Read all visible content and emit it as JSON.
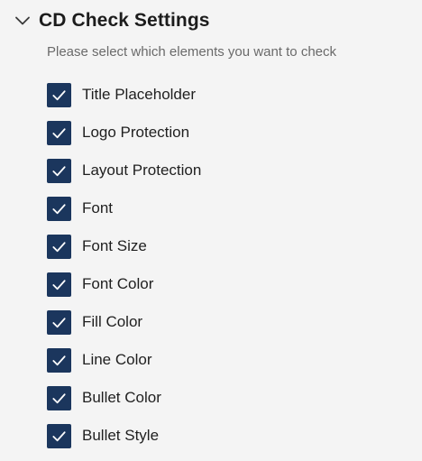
{
  "section": {
    "title": "CD Check Settings",
    "subtitle": "Please select which elements you want to check",
    "collapse_icon": "chevron-down-icon"
  },
  "checkboxes": [
    {
      "label": "Title Placeholder",
      "checked": true
    },
    {
      "label": "Logo Protection",
      "checked": true
    },
    {
      "label": "Layout Protection",
      "checked": true
    },
    {
      "label": "Font",
      "checked": true
    },
    {
      "label": "Font Size",
      "checked": true
    },
    {
      "label": "Font Color",
      "checked": true
    },
    {
      "label": "Fill Color",
      "checked": true
    },
    {
      "label": "Line Color",
      "checked": true
    },
    {
      "label": "Bullet Color",
      "checked": true
    },
    {
      "label": "Bullet Style",
      "checked": true
    }
  ],
  "colors": {
    "checkbox_fill": "#1b365d",
    "checkmark": "#ffffff",
    "background": "#f4f4f4",
    "subtitle_text": "#6a6a6a"
  }
}
